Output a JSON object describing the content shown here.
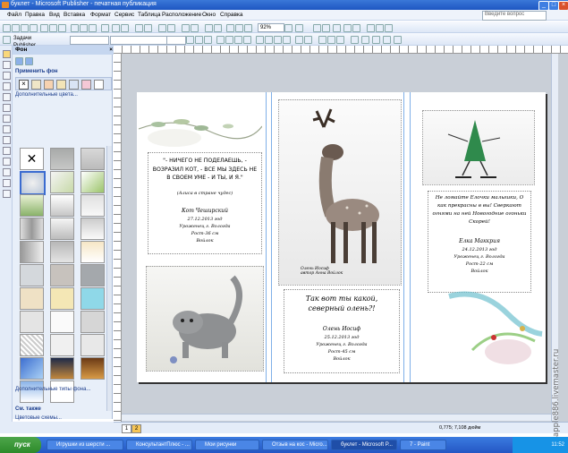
{
  "window": {
    "title": "буклет - Microsoft Publisher - печатная публикация"
  },
  "menu": {
    "items": [
      "Файл",
      "Правка",
      "Вид",
      "Вставка",
      "Формат",
      "Сервис",
      "Таблица",
      "Расположение",
      "Окно",
      "Справка"
    ],
    "help_placeholder": "Введите вопрос"
  },
  "toolbar": {
    "zoom": "92%",
    "publisher_tasks": "Задачи Publisher"
  },
  "taskpane": {
    "title": "Фон",
    "apply_label": "Применить фон",
    "more_colors": "Дополнительные цвета...",
    "more_backgrounds": "Дополнительные типы фона...",
    "see_also": "См. также",
    "color_schemes": "Цветовые схемы..."
  },
  "page": {
    "col1": {
      "quote": "\"- НИЧЕГО НЕ ПОДЕЛАЕШЬ, - ВОЗРАЗИЛ КОТ, - ВСЕ МЫ ЗДЕСЬ НЕ В СВОЕМ УМЕ - И ТЫ, И Я.\"",
      "source": "(Алиса в стране чудес)",
      "name": "Кот Чеширский",
      "date": "27.12.2013 год",
      "place": "Уроженец г. Вологда",
      "height": "Рост-36 см",
      "price": "Войлок"
    },
    "col2": {
      "photo_caption": "Олень Иосиф\nавтор Анна Войлок",
      "heading": "Так вот ты какой, северный олень?!",
      "name": "Олень Иосиф",
      "date": "25.12.2013 год",
      "place": "Уроженец г. Вологда",
      "height": "Рост-45 см",
      "price": "Войлок"
    },
    "col3": {
      "text": "Не ломайте Елочки малышки, О как прекрасны в вы! Сверкают огнями на ней Новогодние огоньки Скорей!",
      "name": "Елка Маккрия",
      "date": "24.12.2013 год",
      "place": "Уроженец г. Вологда",
      "height": "Рост-22 см",
      "price": "Войлок"
    }
  },
  "page_tabs": [
    "1",
    "2"
  ],
  "status": {
    "coords": "0,775; 7,108 дюйм"
  },
  "taskbar": {
    "start": "пуск",
    "tasks": [
      "Игрушки из шерсти ...",
      "КонсультантПлюс - ...",
      "Мои рисунки",
      "Отзыв на кос - Micro...",
      "буклет - Microsoft P...",
      "7 - Paint"
    ],
    "lang": "RU",
    "time": "11:52"
  },
  "watermark": "apple886.livemaster.ru"
}
